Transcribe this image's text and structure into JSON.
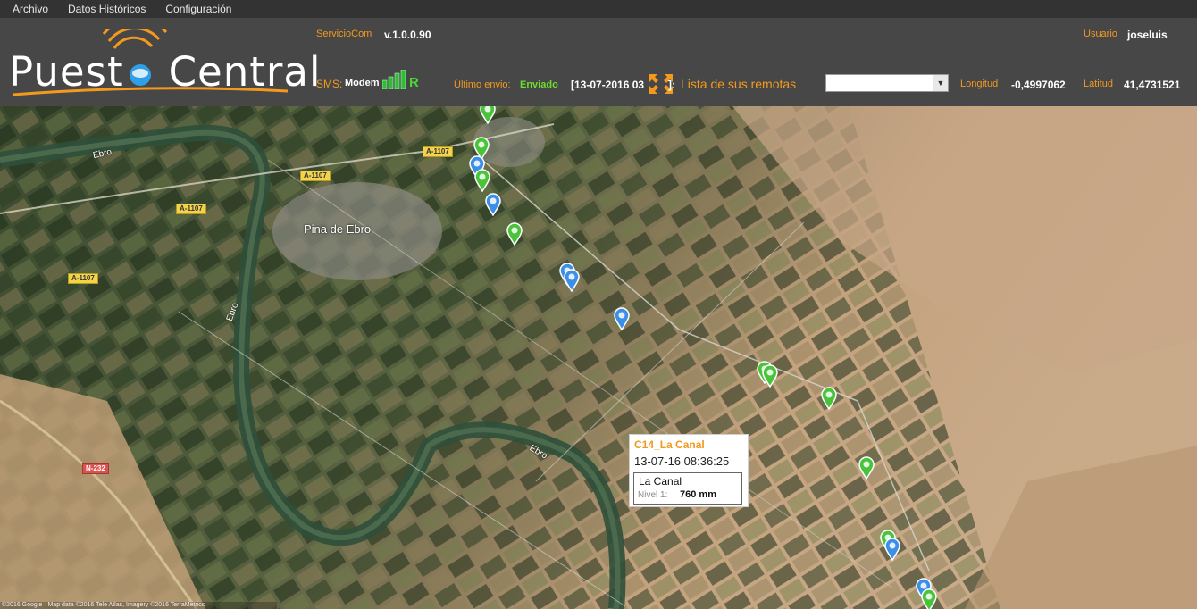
{
  "menu": {
    "items": [
      "Archivo",
      "Datos Históricos",
      "Configuración"
    ]
  },
  "brand": {
    "name_part1": "Puest",
    "name_part2": "Central"
  },
  "header": {
    "service_label": "ServicioCom",
    "version": "v.1.0.0.90",
    "user_label": "Usuario",
    "user_value": "joseluis",
    "sms_label": "SMS:",
    "modem_label": "Modem",
    "signal_r": "R",
    "last_send_label": "Último envio:",
    "last_send_status": "Enviado",
    "last_send_date": "[13-07-2016 03",
    "last_send_trunc": "]:",
    "remotes_label": "Lista de sus remotas",
    "remotes_select_value": "",
    "longitude_label": "Longitud",
    "longitude_value": "-0,4997062",
    "latitude_label": "Latitud",
    "latitude_value": "41,4731521"
  },
  "map": {
    "labels": {
      "town": "Pina de Ebro",
      "river1": "Ebro",
      "river2": "Ebro",
      "river3": "Ebro",
      "road1": "A-1107",
      "road2": "A-1107",
      "road3": "A-1107",
      "road4": "A-1107",
      "road5": "N-232"
    },
    "attribution": "©2016 Google · Map data ©2016 Tele Atlas, Imagery ©2016 TerraMetrics",
    "popup": {
      "title": "C14_La Canal",
      "timestamp": "13-07-16 08:36:25",
      "station": "La Canal",
      "level_label": "Nivel 1:",
      "level_value": "760 mm"
    },
    "markers": [
      {
        "color": "green"
      },
      {
        "color": "green"
      },
      {
        "color": "blue"
      },
      {
        "color": "green"
      },
      {
        "color": "blue"
      },
      {
        "color": "green"
      },
      {
        "color": "blue"
      },
      {
        "color": "blue"
      },
      {
        "color": "blue"
      },
      {
        "color": "green"
      },
      {
        "color": "green"
      },
      {
        "color": "green"
      },
      {
        "color": "green"
      },
      {
        "color": "green"
      },
      {
        "color": "blue"
      },
      {
        "color": "blue"
      },
      {
        "color": "green"
      }
    ]
  },
  "colors": {
    "header_bg": "#474747",
    "menubar_bg": "#333333",
    "accent": "#f39a1e",
    "success": "#6ddc2f",
    "marker_green": "#48c33a",
    "marker_blue": "#3c8fe6"
  }
}
